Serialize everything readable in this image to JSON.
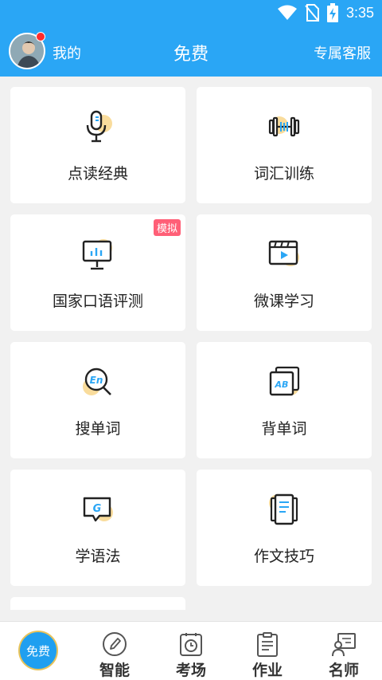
{
  "status_bar": {
    "time": "3:35",
    "icons": [
      "wifi-icon",
      "no-sim-icon",
      "battery-charging-icon"
    ]
  },
  "header": {
    "me_label": "我的",
    "title": "免费",
    "service_label": "专属客服"
  },
  "cards": [
    {
      "label": "点读经典",
      "icon": "microphone-icon"
    },
    {
      "label": "词汇训练",
      "icon": "dumbbell-icon"
    },
    {
      "label": "国家口语评测",
      "icon": "presentation-board-icon",
      "badge": "模拟"
    },
    {
      "label": "微课学习",
      "icon": "video-player-icon"
    },
    {
      "label": "搜单词",
      "icon": "search-en-icon"
    },
    {
      "label": "背单词",
      "icon": "flashcards-ab-icon"
    },
    {
      "label": "学语法",
      "icon": "grammar-bubble-icon"
    },
    {
      "label": "作文技巧",
      "icon": "document-copy-icon"
    }
  ],
  "tabs": [
    {
      "label": "免费",
      "icon": "free-icon",
      "active": true
    },
    {
      "label": "智能",
      "icon": "pencil-circle-icon"
    },
    {
      "label": "考场",
      "icon": "stopwatch-icon"
    },
    {
      "label": "作业",
      "icon": "clipboard-icon"
    },
    {
      "label": "名师",
      "icon": "teacher-board-icon"
    }
  ],
  "colors": {
    "accent": "#2aa6f5",
    "icon_highlight": "#f9dc9c",
    "badge": "#ff5f77"
  }
}
